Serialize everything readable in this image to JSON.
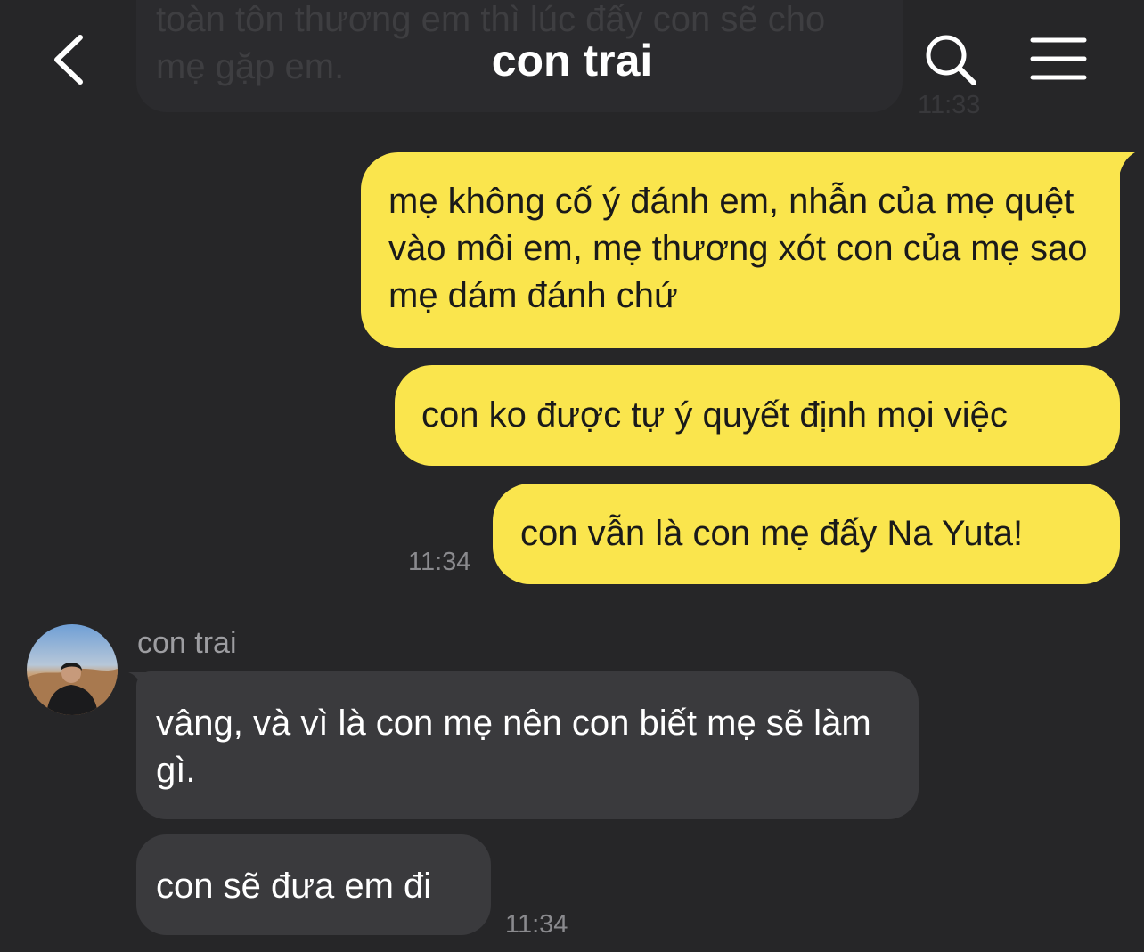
{
  "header": {
    "title": "con trai",
    "back_icon": "chevron-left-icon",
    "search_icon": "search-icon",
    "menu_icon": "hamburger-menu-icon"
  },
  "colors": {
    "background": "#262628",
    "outgoing_bubble": "#fae54d",
    "incoming_bubble": "#3a3a3d",
    "timestamp": "#8a8a8e"
  },
  "previous_message": {
    "text": "toàn tôn thương em thì lúc đấy con sẽ cho mẹ gặp em.",
    "time": "11:33"
  },
  "outgoing": {
    "messages": [
      "mẹ không cố ý đánh em, nhẫn của mẹ quệt vào môi em, mẹ thương xót con của mẹ sao mẹ dám đánh chứ",
      "con ko được tự ý quyết định mọi việc",
      "con vẫn là con mẹ đấy Na Yuta!"
    ],
    "time": "11:34"
  },
  "incoming": {
    "sender": "con trai",
    "messages": [
      "vâng, và vì là con mẹ nên con biết mẹ sẽ làm gì.",
      "con sẽ đưa em đi"
    ],
    "time": "11:34"
  }
}
